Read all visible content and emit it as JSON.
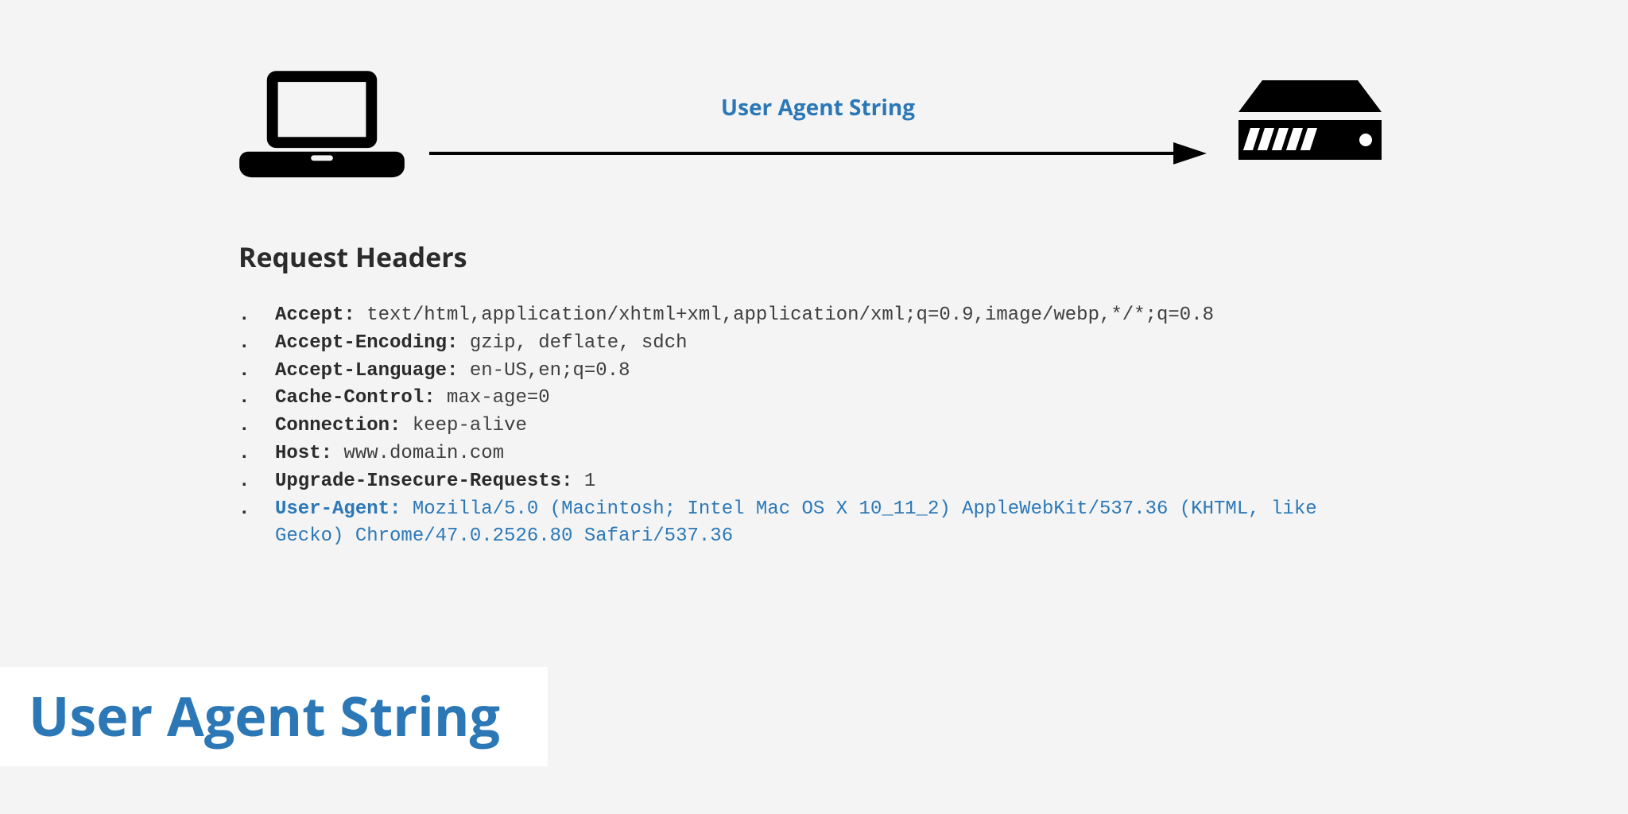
{
  "arrow_label": "User Agent String",
  "section_title": "Request Headers",
  "slide_title": "User Agent String",
  "headers": [
    {
      "name": "Accept",
      "value": "text/html,application/xhtml+xml,application/xml;q=0.9,image/webp,*/*;q=0.8",
      "highlight": false
    },
    {
      "name": "Accept-Encoding",
      "value": "gzip, deflate, sdch",
      "highlight": false
    },
    {
      "name": "Accept-Language",
      "value": "en-US,en;q=0.8",
      "highlight": false
    },
    {
      "name": "Cache-Control",
      "value": "max-age=0",
      "highlight": false
    },
    {
      "name": "Connection",
      "value": "keep-alive",
      "highlight": false
    },
    {
      "name": "Host",
      "value": "www.domain.com",
      "highlight": false
    },
    {
      "name": "Upgrade-Insecure-Requests",
      "value": "1",
      "highlight": false
    },
    {
      "name": "User-Agent",
      "value": "Mozilla/5.0 (Macintosh; Intel Mac OS X 10_11_2) AppleWebKit/537.36 (KHTML, like Gecko) Chrome/47.0.2526.80 Safari/537.36",
      "highlight": true
    }
  ],
  "colors": {
    "accent": "#2c78b7",
    "text": "#2b2b2b"
  }
}
